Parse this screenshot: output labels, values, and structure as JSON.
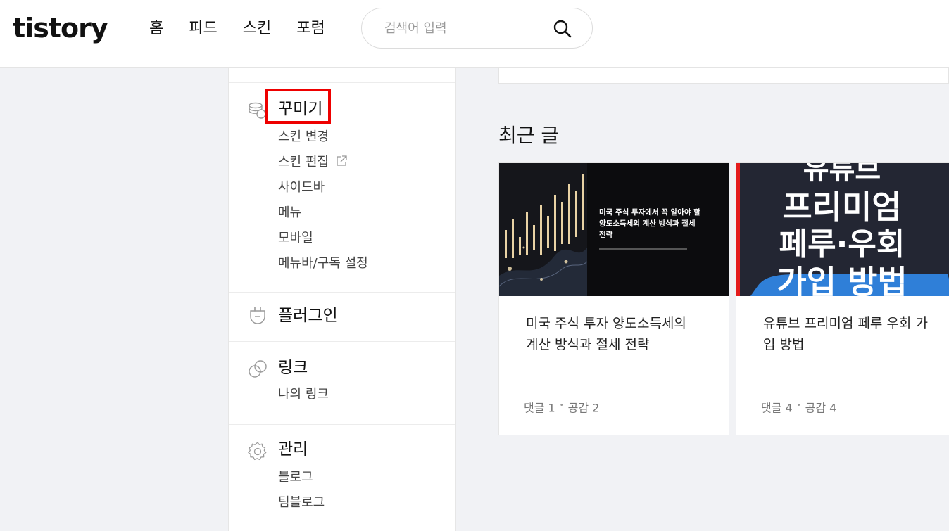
{
  "header": {
    "logo": "tistory",
    "nav": [
      "홈",
      "피드",
      "스킨",
      "포럼"
    ],
    "search_placeholder": "검색어 입력",
    "search_icon": "search-icon"
  },
  "sidebar": {
    "sections": [
      {
        "title": "꾸미기",
        "icon": "coins-icon",
        "highlighted": true,
        "items": [
          "스킨 변경",
          "스킨 편집",
          "사이드바",
          "메뉴",
          "모바일",
          "메뉴바/구독 설정"
        ]
      },
      {
        "title": "플러그인",
        "icon": "plug-icon",
        "items": []
      },
      {
        "title": "링크",
        "icon": "link-icon",
        "items": [
          "나의 링크"
        ]
      },
      {
        "title": "관리",
        "icon": "gear-icon",
        "items": [
          "블로그",
          "팀블로그"
        ]
      }
    ]
  },
  "main": {
    "recent_title": "최근 글",
    "posts": [
      {
        "title_lines": [
          "미국 주식 투자 양도소득세의",
          "계산 방식과 절세 전략"
        ],
        "thumb_text": [
          "미국 주식 투자에서 꼭 알아야 할",
          "양도소득세의 계산 방식과 절세",
          "전략"
        ],
        "comments": "댓글 1",
        "likes": "공감 2"
      },
      {
        "title_lines": [
          "유튜브 프리미엄 페루 우회 가",
          "입 방법"
        ],
        "thumb_text": [
          "유튜브",
          "프리미엄",
          "페루·우회",
          "가입 방법"
        ],
        "comments": "댓글 4",
        "likes": "공감 4"
      }
    ]
  },
  "colors": {
    "highlight": "#ee0000",
    "page_bg": "#f1f2f5",
    "card_bg": "#ffffff"
  }
}
